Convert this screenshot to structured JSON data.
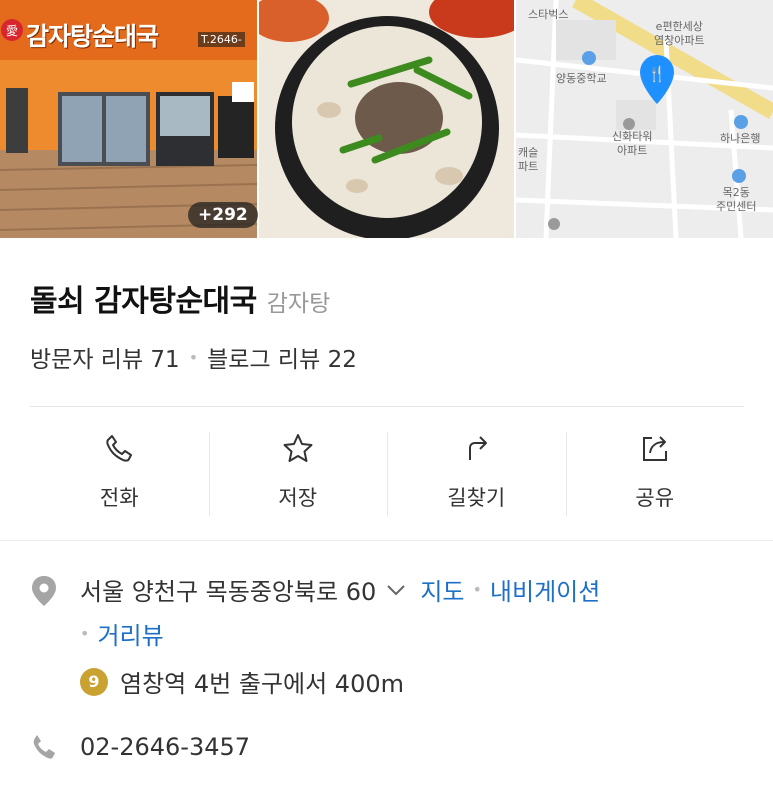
{
  "photos": {
    "storefront_sign": "愛감자탕순대국",
    "storefront_phone": "T.2646-",
    "more_count": "+292",
    "map_labels": {
      "starbucks": "스타벅스",
      "apt1": "e편한세상\n염창아파트",
      "school": "양동중학교",
      "apt2": "신화타워\n아파트",
      "bank": "하나은행",
      "office": "목2동\n주민센터",
      "left_edge": "캐슬\n파트"
    }
  },
  "place": {
    "name": "돌쇠 감자탕순대국",
    "category": "감자탕",
    "visitor_review": "방문자 리뷰 71",
    "blog_review": "블로그 리뷰 22"
  },
  "actions": [
    {
      "label": "전화",
      "icon": "phone-icon"
    },
    {
      "label": "저장",
      "icon": "star-icon"
    },
    {
      "label": "길찾기",
      "icon": "directions-icon"
    },
    {
      "label": "공유",
      "icon": "share-icon"
    }
  ],
  "info": {
    "address": "서울 양천구 목동중앙북로 60",
    "map_link": "지도",
    "navi_link": "내비게이션",
    "street_view_link": "거리뷰",
    "subway_line": "9",
    "subway_text": "염창역 4번 출구에서 400m",
    "phone": "02-2646-3457"
  },
  "colors": {
    "link": "#1e6fc7",
    "subway_line9": "#c9a232",
    "map_pin": "#1e90ff"
  }
}
